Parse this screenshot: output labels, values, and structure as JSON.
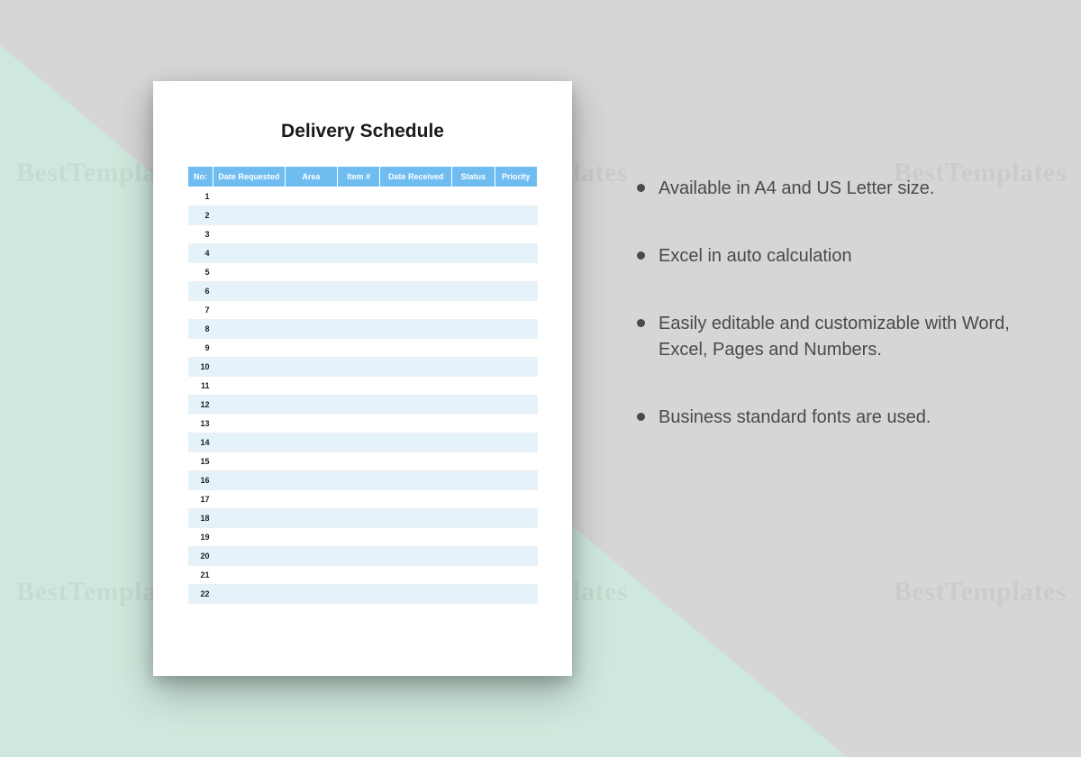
{
  "watermark": "BestTemplates",
  "document": {
    "title": "Delivery Schedule",
    "columns": {
      "no": "No:",
      "date_requested": "Date Requested",
      "area": "Area",
      "item": "Item #",
      "date_received": "Date Received",
      "status": "Status",
      "priority": "Priority"
    },
    "rows": [
      "1",
      "2",
      "3",
      "4",
      "5",
      "6",
      "7",
      "8",
      "9",
      "10",
      "11",
      "12",
      "13",
      "14",
      "15",
      "16",
      "17",
      "18",
      "19",
      "20",
      "21",
      "22"
    ]
  },
  "features": {
    "items": [
      "Available in A4 and US Letter size.",
      "Excel in auto calculation",
      "Easily editable and customizable with Word, Excel, Pages and Numbers.",
      "Business standard fonts are used."
    ]
  }
}
